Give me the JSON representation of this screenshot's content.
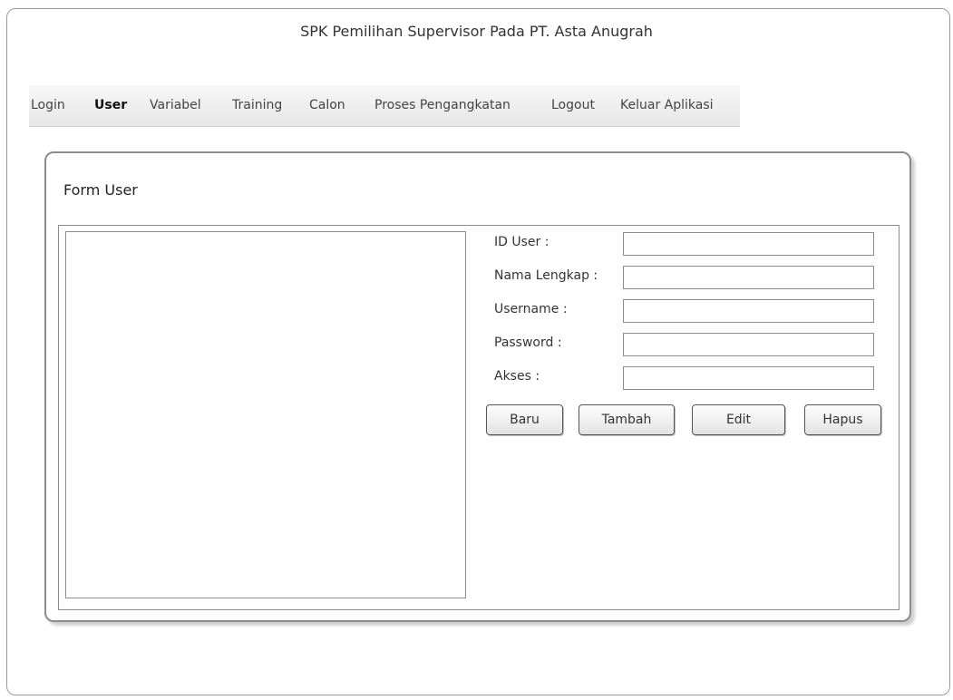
{
  "app": {
    "title": "SPK Pemilihan Supervisor Pada PT. Asta Anugrah"
  },
  "menu": {
    "items": [
      {
        "label": "Login"
      },
      {
        "label": "User"
      },
      {
        "label": "Variabel"
      },
      {
        "label": "Training"
      },
      {
        "label": "Calon"
      },
      {
        "label": "Proses Pengangkatan"
      },
      {
        "label": "Logout"
      },
      {
        "label": "Keluar Aplikasi"
      }
    ],
    "active": "User"
  },
  "form": {
    "title": "Form User",
    "fields": [
      {
        "label": "ID User :",
        "value": ""
      },
      {
        "label": "Nama Lengkap :",
        "value": ""
      },
      {
        "label": "Username :",
        "value": ""
      },
      {
        "label": "Password :",
        "value": ""
      },
      {
        "label": "Akses :",
        "value": ""
      }
    ],
    "buttons": {
      "baru": "Baru",
      "tambah": "Tambah",
      "edit": "Edit",
      "hapus": "Hapus"
    }
  }
}
